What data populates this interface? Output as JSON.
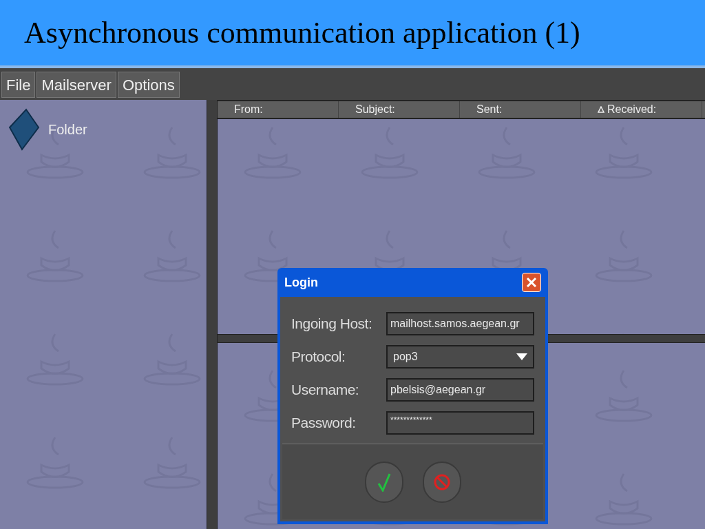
{
  "slide": {
    "title": "Asynchronous communication application (1)"
  },
  "menu": [
    "File",
    "Mailserver",
    "Options"
  ],
  "folders": [
    {
      "label": "Folder"
    }
  ],
  "table": {
    "columns": [
      {
        "label": "From:",
        "sorted": false
      },
      {
        "label": "Subject:",
        "sorted": false
      },
      {
        "label": "Sent:",
        "sorted": false
      },
      {
        "label": "Received:",
        "sorted": true
      }
    ]
  },
  "dialog": {
    "title": "Login",
    "fields": [
      {
        "label": "Ingoing Host:",
        "kind": "text",
        "value": "mailhost.samos.aegean.gr"
      },
      {
        "label": "Protocol:",
        "kind": "select",
        "value": "pop3"
      },
      {
        "label": "Username:",
        "kind": "text",
        "value": "pbelsis@aegean.gr"
      },
      {
        "label": "Password:",
        "kind": "password",
        "value": "*************"
      }
    ]
  }
}
